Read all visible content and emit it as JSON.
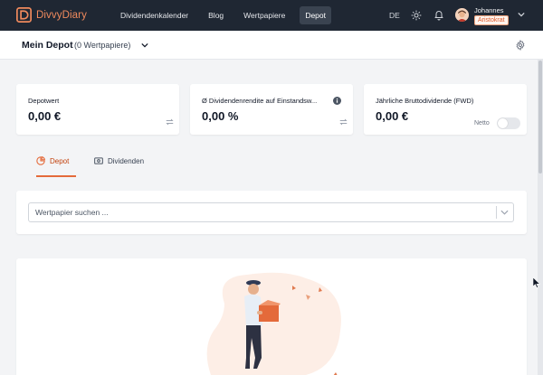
{
  "app": {
    "name": "DivvyDiary",
    "brand_color": "#f08a5d",
    "accent_color": "#e46a3a",
    "nav_bg": "#1f2733"
  },
  "nav": {
    "links": [
      {
        "label": "Dividendenkalender",
        "active": false
      },
      {
        "label": "Blog",
        "active": false
      },
      {
        "label": "Wertpapiere",
        "active": false
      },
      {
        "label": "Depot",
        "active": true
      }
    ],
    "language": "DE",
    "icons": [
      "sun-icon",
      "bell-icon",
      "chevron-down-icon"
    ]
  },
  "user": {
    "name": "Johannes",
    "badge": "Aristokrat"
  },
  "depot_header": {
    "title": "Mein Depot",
    "count": "(0 Wertpapiere)"
  },
  "stats": {
    "depotwert": {
      "label": "Depotwert",
      "value": "0,00 €"
    },
    "rendite": {
      "label": "Ø Dividendenrendite auf Einstandsw...",
      "value": "0,00 %"
    },
    "brutto": {
      "label": "Jährliche Bruttodividende (FWD)",
      "value": "0,00 €",
      "toggle_label": "Netto",
      "toggle_on": false
    }
  },
  "tabs": [
    {
      "label": "Depot",
      "active": true
    },
    {
      "label": "Dividenden",
      "active": false
    }
  ],
  "search": {
    "placeholder": "Wertpapier suchen ..."
  }
}
